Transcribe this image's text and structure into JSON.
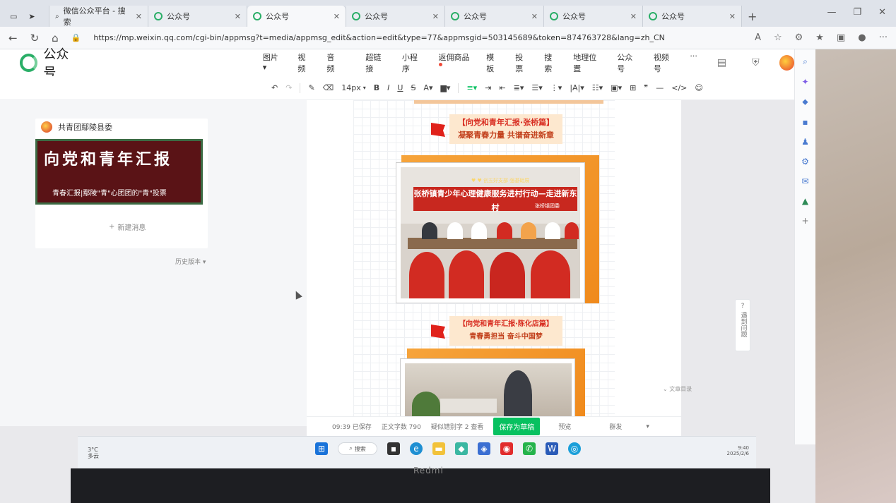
{
  "browser": {
    "tabs": [
      {
        "label": "",
        "active": false
      },
      {
        "label": "微信公众平台 - 搜索",
        "active": false
      },
      {
        "label": "公众号",
        "active": false
      },
      {
        "label": "公众号",
        "active": true
      },
      {
        "label": "公众号",
        "active": false
      },
      {
        "label": "公众号",
        "active": false
      },
      {
        "label": "公众号",
        "active": false
      },
      {
        "label": "公众号",
        "active": false
      }
    ],
    "url": "https://mp.weixin.qq.com/cgi-bin/appmsg?t=media/appmsg_edit&action=edit&type=77&appmsgid=503145689&token=874763728&lang=zh_CN",
    "window_controls": [
      "—",
      "❐",
      "✕"
    ]
  },
  "editor": {
    "logo_text": "公众号",
    "menu": [
      "图片 ▾",
      "视频",
      "音频",
      "超链接",
      "小程序",
      "返佣商品",
      "模板",
      "投票",
      "搜索",
      "地理位置",
      "公众号",
      "视频号",
      "···"
    ],
    "menu_dot_index": 5,
    "font_size": "14px"
  },
  "left_panel": {
    "account_name": "共青团鄢陵县委",
    "cover_title": "向党和青年汇报",
    "cover_subtitle": "青春汇报|鄢陵\"青\"心团团的\"青\"投票",
    "new_message": "新建消息",
    "history": "历史版本 ▾"
  },
  "article": {
    "section1": {
      "title": "【向党和青年汇报·张桥篇】",
      "subtitle": "凝聚青春力量 共谱奋进新章",
      "banner": "张桥镇青少年心理健康服务进村行动—走进新东村",
      "banner_top": "♥ ♥ 创五好支部  强基础展",
      "banner_sub": "张桥镇团委"
    },
    "section2": {
      "title": "【向党和青年汇报·陈化店篇】",
      "subtitle": "青春勇担当 奋斗中国梦"
    }
  },
  "status_bar": {
    "saved": "09:39 已保存",
    "word_count": "正文字数 790",
    "typo": "疑似错别字 2  查看",
    "save_draft": "保存为草稿",
    "preview": "预览",
    "publish": "群发"
  },
  "floating": {
    "help": "遇到问题",
    "outline": "文章目录"
  },
  "taskbar": {
    "weather_temp": "3°C",
    "weather_text": "多云",
    "search": "搜索",
    "time": "9:40",
    "date": "2025/2/6"
  },
  "laptop_brand": "Redmi"
}
